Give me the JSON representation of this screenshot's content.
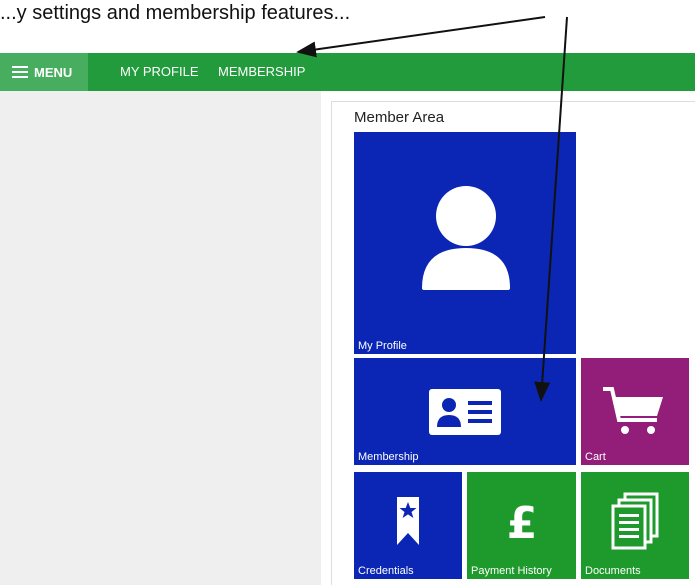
{
  "intro": {
    "text": "...y settings and membership features..."
  },
  "navbar": {
    "menu_label": "MENU",
    "links": [
      "MY PROFILE",
      "MEMBERSHIP"
    ],
    "color": "#229b3c"
  },
  "member_area": {
    "title": "Member Area",
    "tiles": [
      {
        "label": "My Profile",
        "icon": "user-icon",
        "color": "#0b26b4"
      },
      {
        "label": "Membership",
        "icon": "id-card-icon",
        "color": "#0b26b4"
      },
      {
        "label": "Cart",
        "icon": "cart-icon",
        "color": "#921e79"
      },
      {
        "label": "Credentials",
        "icon": "bookmark-star-icon",
        "color": "#0b26b4"
      },
      {
        "label": "Payment History",
        "icon": "pound-icon",
        "color": "#1e9a2c"
      },
      {
        "label": "Documents",
        "icon": "documents-icon",
        "color": "#1e9a2c"
      }
    ]
  }
}
